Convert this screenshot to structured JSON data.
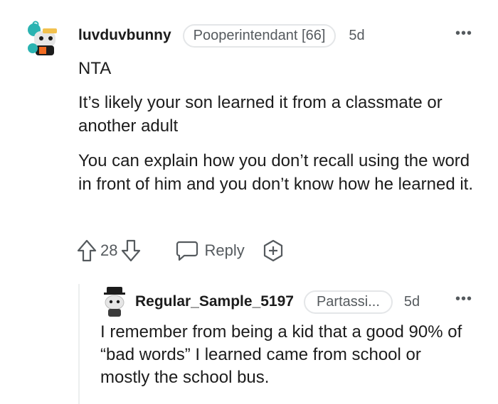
{
  "comment": {
    "username": "luvduvbunny",
    "flair": "Pooperintendant [66]",
    "age": "5d",
    "more_label": "•••",
    "paragraphs": [
      "NTA",
      "It’s likely your son learned it from a classmate or another adult",
      "You can explain how you don’t recall using the word in front of him and you don’t know how he learned it."
    ],
    "score": "28",
    "reply_label": "Reply",
    "icons": [
      "upvote-icon",
      "downvote-icon",
      "reply-bubble-icon",
      "award-icon"
    ]
  },
  "reply": {
    "username": "Regular_Sample_5197",
    "flair": "Partassi...",
    "age": "5d",
    "more_label": "•••",
    "text": "I remember from being a kid that a good 90% of “bad words” I learned came from school or mostly the school bus."
  },
  "colors": {
    "text": "#1c1c1c",
    "meta": "#555a5e",
    "border": "#e4e6e8",
    "avatar_teal": "#2bb3b1",
    "avatar_orange": "#f26b21"
  }
}
